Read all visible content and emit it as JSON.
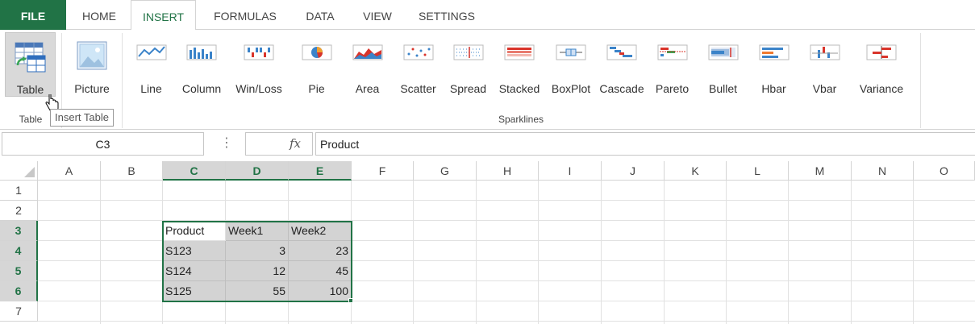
{
  "tabs": {
    "file": "FILE",
    "home": "HOME",
    "insert": "INSERT",
    "formulas": "FORMULAS",
    "data": "DATA",
    "view": "VIEW",
    "settings": "SETTINGS"
  },
  "ribbon": {
    "table_button": "Table",
    "picture_button": "Picture",
    "table_group_label": "Table",
    "sparklines_group_label": "Sparklines",
    "tooltip": "Insert Table",
    "sparklines": [
      "Line",
      "Column",
      "Win/Loss",
      "Pie",
      "Area",
      "Scatter",
      "Spread",
      "Stacked",
      "BoxPlot",
      "Cascade",
      "Pareto",
      "Bullet",
      "Hbar",
      "Vbar",
      "Variance"
    ]
  },
  "formula_bar": {
    "name_box": "C3",
    "dots": "⋮",
    "fx": "fx",
    "formula": "Product"
  },
  "columns": [
    "A",
    "B",
    "C",
    "D",
    "E",
    "F",
    "G",
    "H",
    "I",
    "J",
    "K",
    "L",
    "M",
    "N",
    "O"
  ],
  "rows": [
    "1",
    "2",
    "3",
    "4",
    "5",
    "6",
    "7"
  ],
  "cells": {
    "c3": "Product",
    "d3": "Week1",
    "e3": "Week2",
    "c4": "S123",
    "d4": "3",
    "e4": "23",
    "c5": "S124",
    "d5": "12",
    "e5": "45",
    "c6": "S125",
    "d6": "55",
    "e6": "100"
  },
  "colors": {
    "accent": "#217346",
    "selection_fill": "#d3d3d3"
  }
}
